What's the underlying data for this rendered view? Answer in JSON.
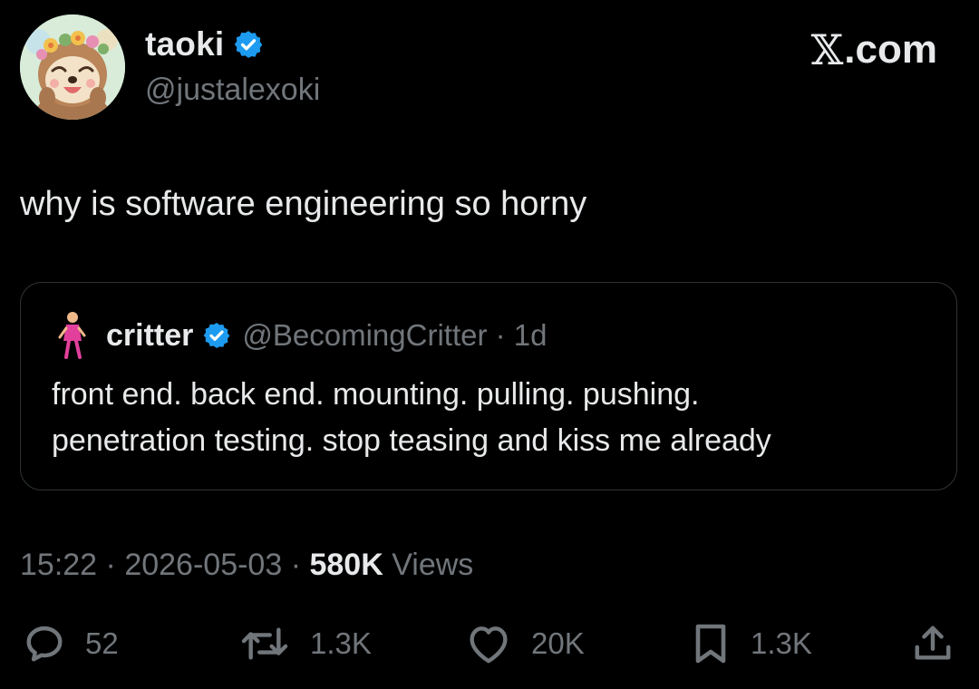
{
  "author": {
    "display_name": "taoki",
    "handle": "@justalexoki",
    "verified": true
  },
  "brand": {
    "x_glyph": "𝕏",
    "suffix": ".com"
  },
  "tweet": {
    "text": "why is software engineering so horny",
    "time": "15:22",
    "sep1": "·",
    "date": "2026-05-03",
    "sep2": "·",
    "views_count": "580K",
    "views_label": "Views"
  },
  "quote": {
    "display_name": "critter",
    "handle_and_time": "@BecomingCritter · 1d",
    "verified": true,
    "lines": [
      "front end. back end. mounting. pulling. pushing.",
      "penetration testing. stop teasing and kiss me already"
    ]
  },
  "actions": {
    "replies": "52",
    "reposts": "1.3K",
    "likes": "20K",
    "bookmarks": "1.3K"
  },
  "colors": {
    "background": "#000000",
    "text_primary": "#e7e9ea",
    "text_secondary": "#71767b",
    "verified_blue": "#1d9bf0",
    "card_border": "#2f3336"
  },
  "icons": [
    "verified-badge-icon",
    "reply-icon",
    "repost-icon",
    "like-icon",
    "bookmark-icon",
    "share-icon"
  ]
}
